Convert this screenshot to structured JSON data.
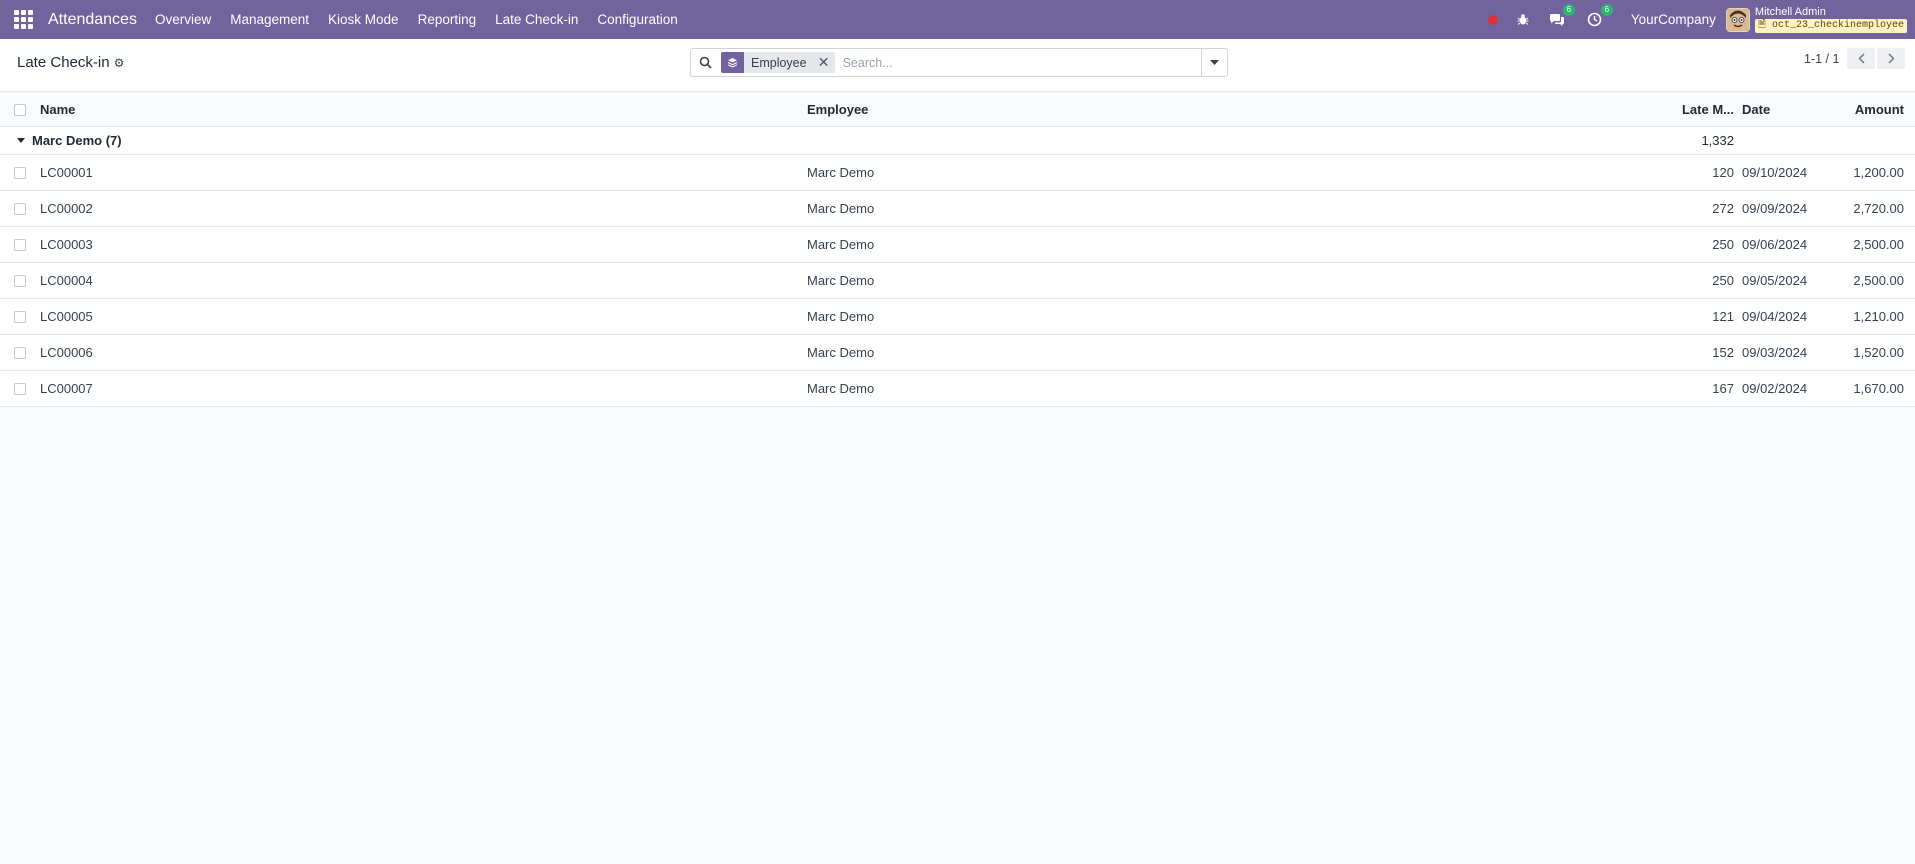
{
  "navbar": {
    "app_name": "Attendances",
    "menu": [
      "Overview",
      "Management",
      "Kiosk Mode",
      "Reporting",
      "Late Check-in",
      "Configuration"
    ],
    "chat_badge": "6",
    "activity_badge": "6",
    "company": "YourCompany",
    "user_name": "Mitchell Admin",
    "db_name": "oct_23_checkinemployee"
  },
  "control": {
    "title": "Late Check-in",
    "facet_label": "Employee",
    "search_placeholder": "Search...",
    "pager": "1-1 / 1"
  },
  "table": {
    "columns": {
      "name": "Name",
      "employee": "Employee",
      "late_minutes": "Late M...",
      "date": "Date",
      "amount": "Amount"
    },
    "group": {
      "label": "Marc Demo (7)",
      "late_total": "1,332"
    },
    "rows": [
      {
        "name": "LC00001",
        "employee": "Marc Demo",
        "late": "120",
        "date": "09/10/2024",
        "amount": "1,200.00"
      },
      {
        "name": "LC00002",
        "employee": "Marc Demo",
        "late": "272",
        "date": "09/09/2024",
        "amount": "2,720.00"
      },
      {
        "name": "LC00003",
        "employee": "Marc Demo",
        "late": "250",
        "date": "09/06/2024",
        "amount": "2,500.00"
      },
      {
        "name": "LC00004",
        "employee": "Marc Demo",
        "late": "250",
        "date": "09/05/2024",
        "amount": "2,500.00"
      },
      {
        "name": "LC00005",
        "employee": "Marc Demo",
        "late": "121",
        "date": "09/04/2024",
        "amount": "1,210.00"
      },
      {
        "name": "LC00006",
        "employee": "Marc Demo",
        "late": "152",
        "date": "09/03/2024",
        "amount": "1,520.00"
      },
      {
        "name": "LC00007",
        "employee": "Marc Demo",
        "late": "167",
        "date": "09/02/2024",
        "amount": "1,670.00"
      }
    ]
  },
  "colors": {
    "navbar": "#71639e",
    "badge": "#2bb673",
    "alert": "#d9333f"
  },
  "icons": [
    "apps-grid-icon",
    "bug-icon",
    "chat-icon",
    "clock-icon",
    "search-icon",
    "layers-icon",
    "close-icon",
    "caret-down-icon",
    "chevron-left-icon",
    "chevron-right-icon",
    "gear-icon"
  ]
}
